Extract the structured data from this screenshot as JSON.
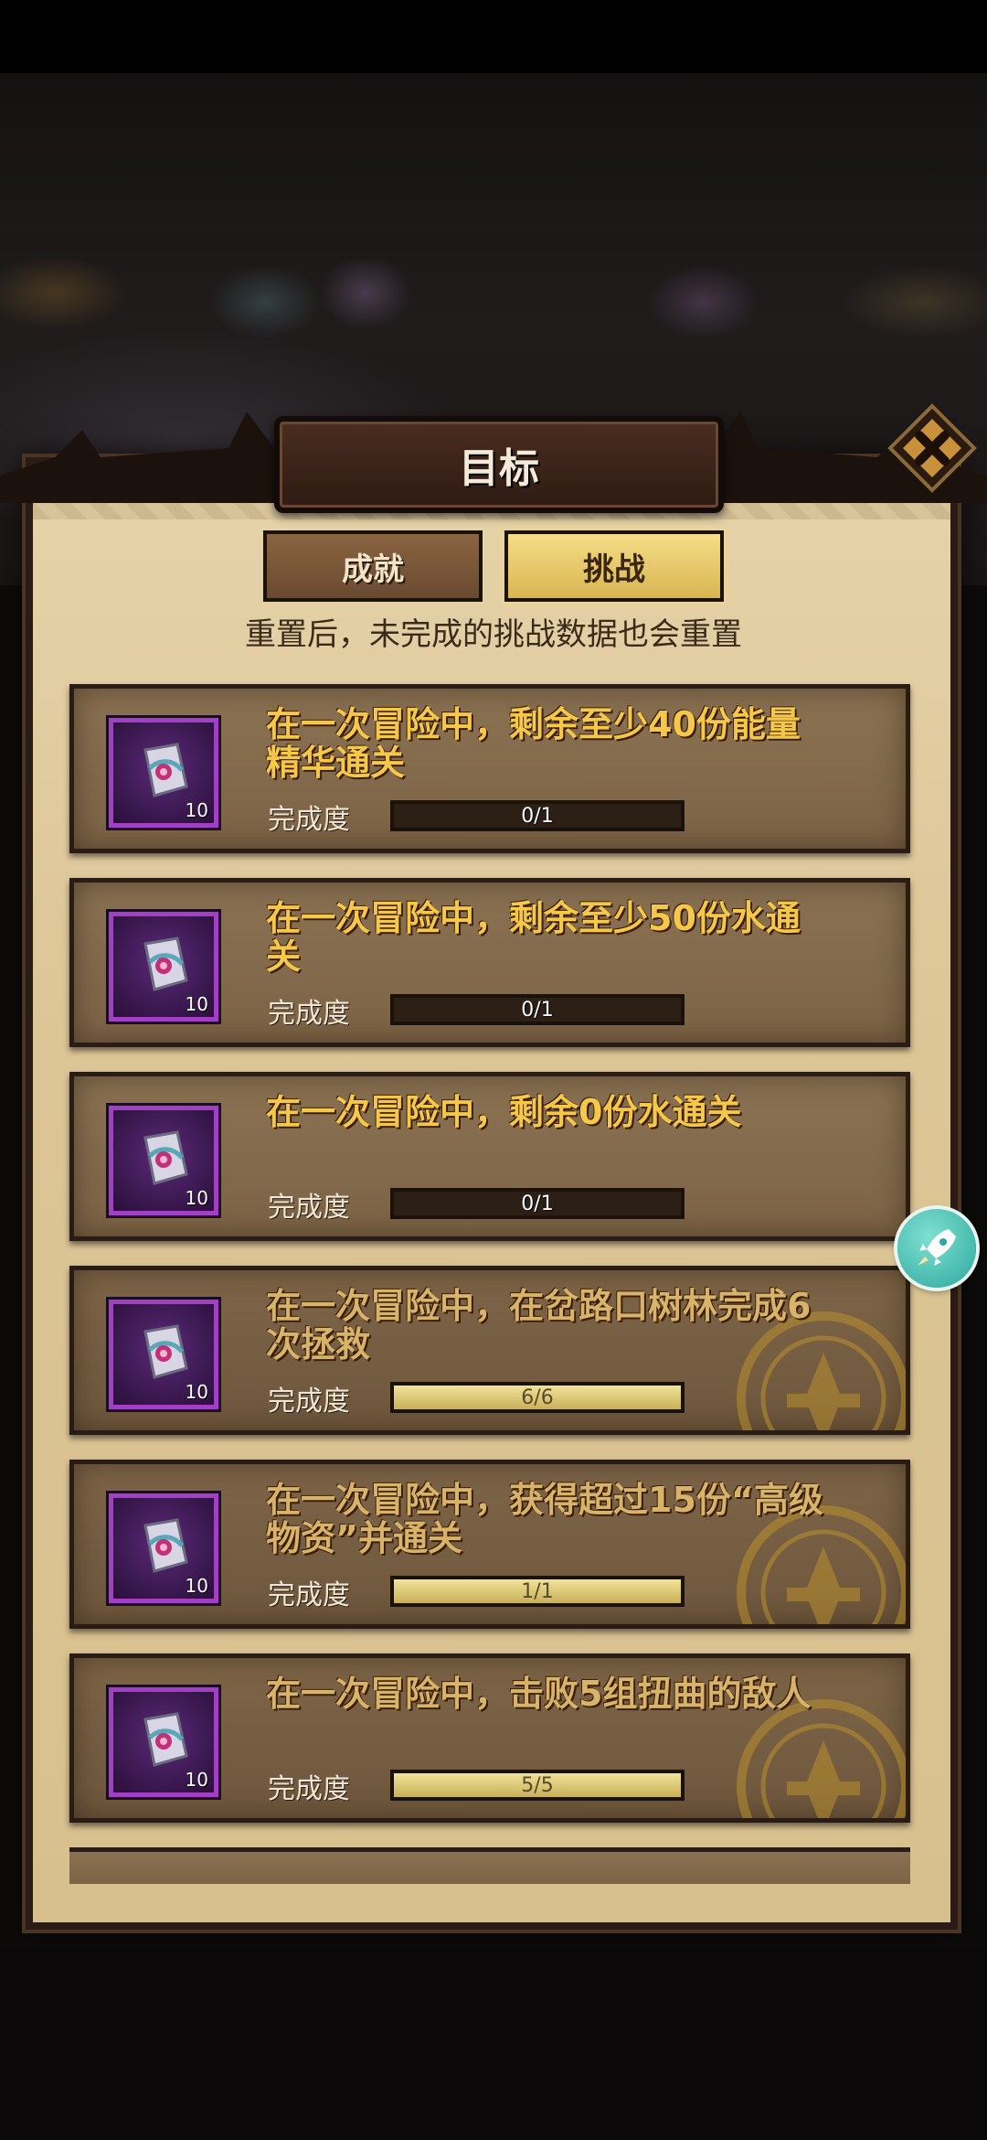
{
  "dialog": {
    "title": "目标",
    "close_icon": "close-x-icon"
  },
  "tabs": [
    {
      "label": "成就",
      "active": false
    },
    {
      "label": "挑战",
      "active": true
    }
  ],
  "notice": "重置后，未完成的挑战数据也会重置",
  "challenges": [
    {
      "desc_line1": "在一次冒险中，剩余至少40份能量",
      "desc_line2": "精华通关",
      "reward_count": "10",
      "progress_label": "完成度",
      "progress_text": "0/1",
      "progress": 0,
      "completed": false
    },
    {
      "desc_line1": "在一次冒险中，剩余至少50份水通",
      "desc_line2": "关",
      "reward_count": "10",
      "progress_label": "完成度",
      "progress_text": "0/1",
      "progress": 0,
      "completed": false
    },
    {
      "desc_line1": "在一次冒险中，剩余0份水通关",
      "desc_line2": "",
      "reward_count": "10",
      "progress_label": "完成度",
      "progress_text": "0/1",
      "progress": 0,
      "completed": false
    },
    {
      "desc_line1": "在一次冒险中，在岔路口树林完成6",
      "desc_line2": "次拯救",
      "reward_count": "10",
      "progress_label": "完成度",
      "progress_text": "6/6",
      "progress": 1,
      "completed": true
    },
    {
      "desc_line1": "在一次冒险中，获得超过15份“高级",
      "desc_line2": "物资”并通关",
      "reward_count": "10",
      "progress_label": "完成度",
      "progress_text": "1/1",
      "progress": 1,
      "completed": true
    },
    {
      "desc_line1": "在一次冒险中，击败5组扭曲的敌人",
      "desc_line2": "",
      "reward_count": "10",
      "progress_label": "完成度",
      "progress_text": "5/5",
      "progress": 1,
      "completed": true
    }
  ],
  "colors": {
    "desc_text": "#f6c84a",
    "reward_border": "#a23fc4",
    "active_tab": "#f5dd88"
  },
  "floating_button": {
    "icon": "rocket-icon"
  }
}
